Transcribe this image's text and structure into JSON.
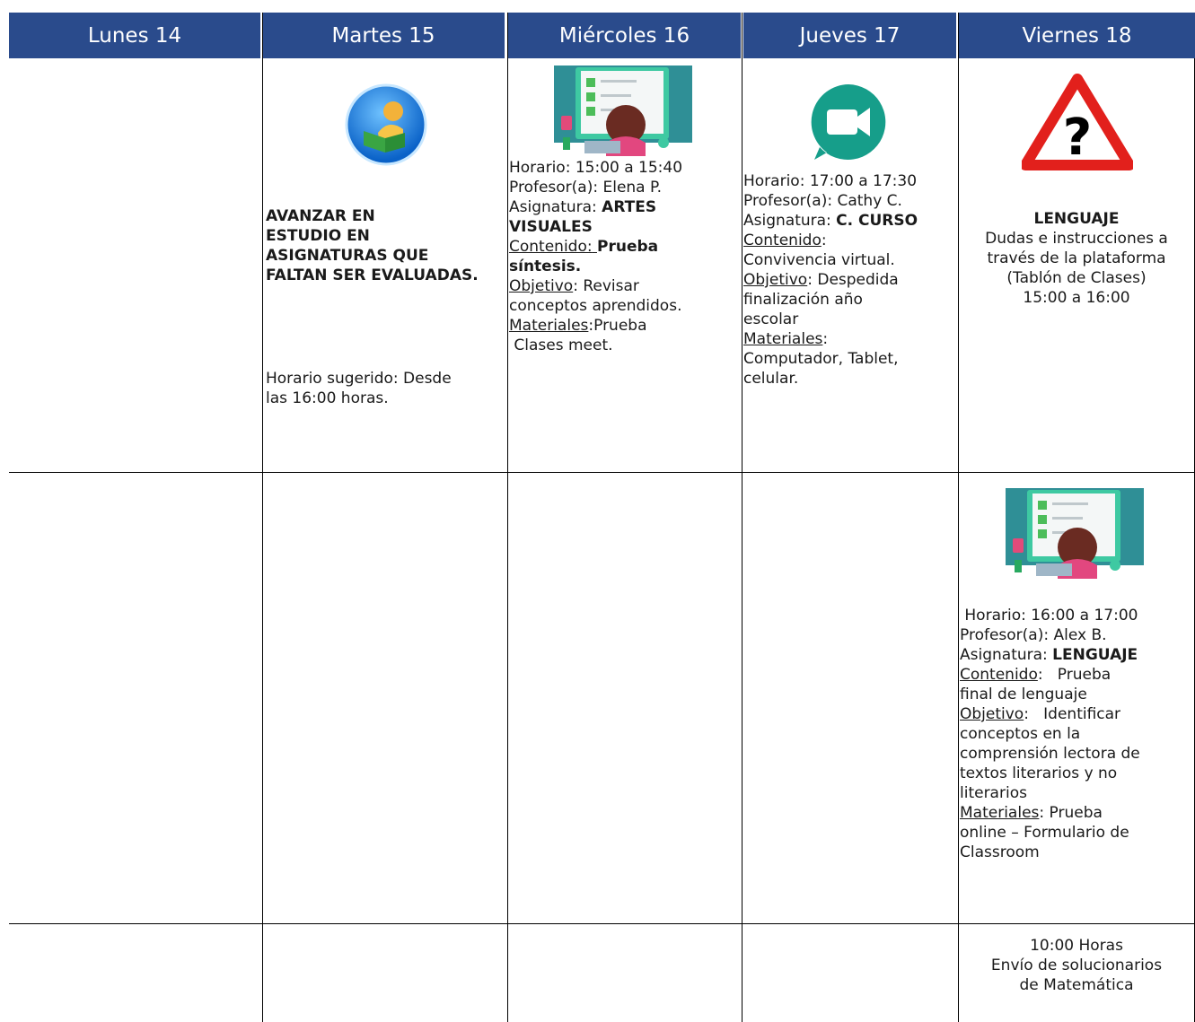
{
  "days": [
    "Lunes 14",
    "Martes 15",
    "Miércoles 16",
    "Jueves 17",
    "Viernes 18"
  ],
  "colors": {
    "header_bg": "#2a4b8c",
    "header_text": "#ffffff"
  },
  "icons": {
    "martes": "student-reading-icon",
    "miercoles": "online-test-illustration",
    "jueves": "google-meet-icon",
    "viernes": "question-warning-icon",
    "viernes_row2": "online-test-illustration"
  },
  "martes": {
    "task": "AVANZAR EN ESTUDIO EN ASIGNATURAS QUE FALTAN SER EVALUADAS.",
    "task_lines": [
      "AVANZAR EN",
      "ESTUDIO EN",
      "ASIGNATURAS QUE",
      "FALTAN SER EVALUADAS."
    ],
    "schedule_lines": [
      "Horario sugerido: Desde",
      "las 16:00 horas."
    ]
  },
  "miercoles": {
    "horario": "Horario: 15:00 a 15:40",
    "profesor": "Profesor(a): Elena P.",
    "asignatura_label": "Asignatura: ",
    "asignatura_value_1": "ARTES",
    "asignatura_value_2": "VISUALES",
    "contenido_label": "Contenido:",
    "contenido_value_1": "Prueba",
    "contenido_value_2": "síntesis.",
    "objetivo_label": "Objetivo",
    "objetivo_value_1": ": Revisar",
    "objetivo_value_2": "conceptos aprendidos.",
    "materiales_label": "Materiales",
    "materiales_value_1": ":Prueba",
    "materiales_value_2": " Clases meet."
  },
  "jueves": {
    "horario": "Horario: 17:00 a 17:30",
    "profesor": "Profesor(a): Cathy C.",
    "asignatura_label": "Asignatura: ",
    "asignatura_value": "C. CURSO",
    "contenido_label": "Contenido",
    "contenido_value_1": ":",
    "contenido_value_2": "Convivencia virtual.",
    "objetivo_label": "Objetivo",
    "objetivo_value_1": ": Despedida",
    "objetivo_value_2": "finalización año",
    "objetivo_value_3": "escolar",
    "materiales_label": "Materiales",
    "materiales_value_1": ":",
    "materiales_value_2": "Computador, Tablet,",
    "materiales_value_3": "celular."
  },
  "viernes": {
    "subject": "LENGUAJE",
    "lines": [
      "Dudas e instrucciones a",
      "través de la plataforma",
      "(Tablón de Clases)",
      "15:00 a 16:00"
    ]
  },
  "viernes_row2": {
    "horario": " Horario: 16:00 a 17:00",
    "profesor": "Profesor(a): Alex B.",
    "asignatura_label": "Asignatura: ",
    "asignatura_value": "LENGUAJE",
    "contenido_label": "Contenido",
    "contenido_value_1": ":   Prueba",
    "contenido_value_2": "final de lenguaje",
    "objetivo_label": "Objetivo",
    "objetivo_value_1": ":   Identificar",
    "objetivo_lines": [
      "conceptos en la",
      "comprensión lectora de",
      "textos literarios y no",
      "literarios"
    ],
    "materiales_label": "Materiales",
    "materiales_value_1": ": Prueba",
    "materiales_lines": [
      "online – Formulario de",
      "Classroom"
    ]
  },
  "viernes_row3": {
    "lines": [
      "10:00 Horas",
      "Envío de solucionarios",
      "de Matemática"
    ]
  }
}
